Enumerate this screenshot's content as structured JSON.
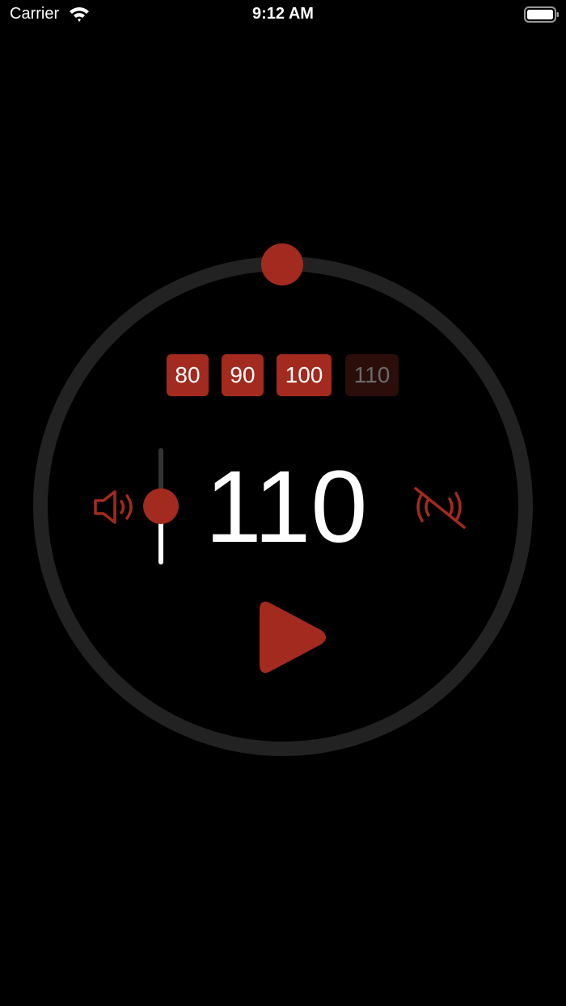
{
  "status_bar": {
    "carrier": "Carrier",
    "time": "9:12 AM",
    "wifi_icon": "wifi-icon",
    "battery_icon": "battery-icon"
  },
  "colors": {
    "accent": "#a32a1e",
    "ring": "#222222",
    "preset_inactive": "#2b0d0a",
    "text": "#ffffff",
    "text_dim": "#6a6a6a",
    "background": "#000000"
  },
  "presets": [
    {
      "label": "80",
      "active": true
    },
    {
      "label": "90",
      "active": true
    },
    {
      "label": "100",
      "active": true
    },
    {
      "label": "110",
      "active": false
    }
  ],
  "tempo": {
    "value": "110"
  },
  "volume": {
    "icon": "speaker-icon",
    "level": 0.5
  },
  "vibration": {
    "icon": "vibration-off-icon",
    "enabled": false
  },
  "play": {
    "icon": "play-icon"
  }
}
